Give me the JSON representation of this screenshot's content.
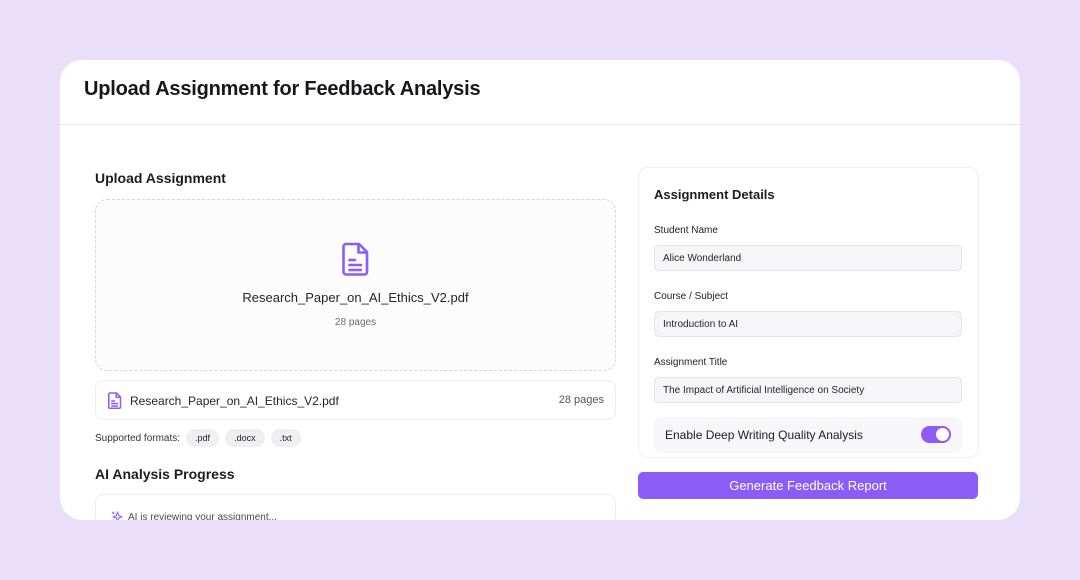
{
  "header": {
    "title": "Upload Assignment for Feedback Analysis"
  },
  "upload": {
    "section_title": "Upload Assignment",
    "dropzone": {
      "filename": "Research_Paper_on_AI_Ethics_V2.pdf",
      "pages": "28 pages",
      "icon": "file-text-icon"
    },
    "file": {
      "filename": "Research_Paper_on_AI_Ethics_V2.pdf",
      "pages": "28 pages",
      "icon": "file-text-icon"
    },
    "formats_label": "Supported formats:",
    "formats": [
      ".pdf",
      ".docx",
      ".txt"
    ]
  },
  "progress": {
    "section_title": "AI Analysis Progress",
    "status_text": "AI is reviewing your assignment...",
    "icon": "sparkle-icon"
  },
  "details": {
    "title": "Assignment Details",
    "student_name_label": "Student Name",
    "student_name_value": "Alice Wonderland",
    "course_label": "Course / Subject",
    "course_value": "Introduction to AI",
    "assignment_title_label": "Assignment Title",
    "assignment_title_value": "The Impact of Artificial Intelligence on Society",
    "deep_analysis_label": "Enable Deep Writing Quality Analysis",
    "deep_analysis_enabled": true
  },
  "actions": {
    "generate_label": "Generate Feedback Report"
  },
  "colors": {
    "accent": "#8b5cf6",
    "background": "#e9dff8"
  }
}
